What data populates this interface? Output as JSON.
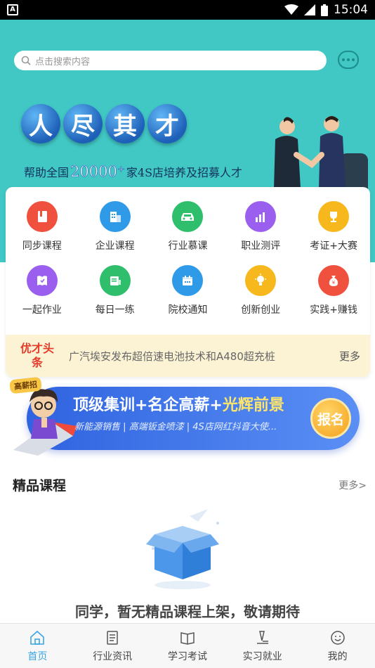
{
  "status_bar": {
    "time": "15:04",
    "left_icon": "A"
  },
  "search": {
    "placeholder": "点击搜索内容"
  },
  "hero": {
    "slogan_chars": [
      "人",
      "尽",
      "其",
      "才"
    ],
    "sub_prefix": "帮助全国",
    "sub_number": "20000⁺",
    "sub_suffix": "家4S店培养及招募人才"
  },
  "grid": [
    {
      "label": "同步课程",
      "icon": "book-icon",
      "color": "#f0513f"
    },
    {
      "label": "企业课程",
      "icon": "building-icon",
      "color": "#2f9be8"
    },
    {
      "label": "行业慕课",
      "icon": "car-icon",
      "color": "#2fbf6c"
    },
    {
      "label": "职业测评",
      "icon": "chart-icon",
      "color": "#9b5ff0"
    },
    {
      "label": "考证+大赛",
      "icon": "trophy-icon",
      "color": "#f6b81c"
    },
    {
      "label": "一起作业",
      "icon": "homework-icon",
      "color": "#9b5ff0"
    },
    {
      "label": "每日一练",
      "icon": "practice-icon",
      "color": "#2fbf6c"
    },
    {
      "label": "院校通知",
      "icon": "calendar-icon",
      "color": "#2f9be8"
    },
    {
      "label": "创新创业",
      "icon": "lightbulb-icon",
      "color": "#f6b81c"
    },
    {
      "label": "实践+赚钱",
      "icon": "money-bag-icon",
      "color": "#f0513f"
    }
  ],
  "news": {
    "tag_line1": "优才头",
    "tag_line2": "条",
    "headline": "广汽埃安发布超倍速电池技术和A480超充桩",
    "more": "更多"
  },
  "promo": {
    "badge": "高薪招",
    "title_part1": "顶级集训+名企高薪+",
    "title_part2": "光辉前景",
    "subtitle": "新能源销售 | 高端钣金喷漆 | 4S店网红抖音大使...",
    "button": "报名"
  },
  "section": {
    "title": "精品课程",
    "more": "更多>"
  },
  "empty_message": "同学，暂无精品课程上架，敬请期待",
  "tabs": [
    {
      "label": "首页",
      "icon": "home-icon",
      "active": true
    },
    {
      "label": "行业资讯",
      "icon": "news-icon",
      "active": false
    },
    {
      "label": "学习考试",
      "icon": "open-book-icon",
      "active": false
    },
    {
      "label": "实习就业",
      "icon": "pen-icon",
      "active": false
    },
    {
      "label": "我的",
      "icon": "smile-icon",
      "active": false
    }
  ],
  "colors": {
    "hero_bg": "#41c7c4",
    "accent": "#3aa6e0",
    "news_tag": "#e53c2a"
  }
}
